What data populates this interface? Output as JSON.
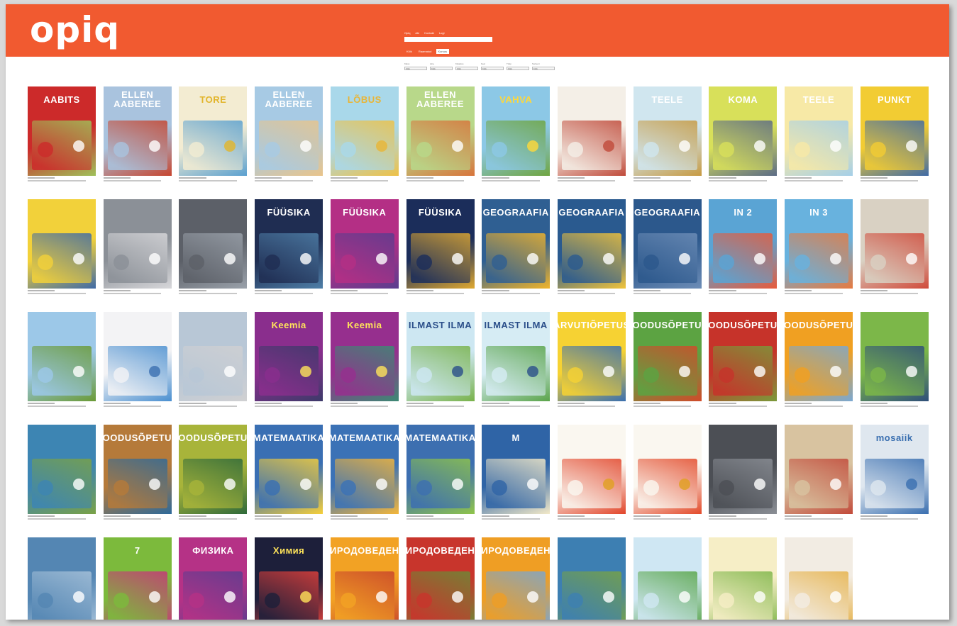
{
  "colors": {
    "accent": "#f15a30"
  },
  "header": {
    "logo": "opiq",
    "nav": [
      "Opiq",
      "Abi",
      "Kontakt",
      "Logi"
    ],
    "search_placeholder": "",
    "tabs": [
      {
        "label": "Kõik",
        "active": false
      },
      {
        "label": "Raamatud",
        "active": false
      },
      {
        "label": "Kursus",
        "active": true
      }
    ],
    "filters": [
      {
        "label": "Klass",
        "value": "Kõik"
      },
      {
        "label": "Aine",
        "value": "Kõik"
      },
      {
        "label": "Kirjastus",
        "value": "Kõik"
      },
      {
        "label": "Keel",
        "value": "Kõik"
      },
      {
        "label": "Tüüp",
        "value": "Kõik"
      },
      {
        "label": "Sorteeri",
        "value": "Kõik"
      }
    ]
  },
  "books": [
    [
      {
        "title": "AABITS",
        "c1": "#cc2a2a",
        "c2": "#9fc25a",
        "tc": "#ffffff"
      },
      {
        "title": "ELLEN AABEREE",
        "c1": "#a9c3de",
        "c2": "#c6452f",
        "tc": "#ffffff"
      },
      {
        "title": "TORE",
        "c1": "#f3ecd2",
        "c2": "#5aa0d0",
        "tc": "#e2b52a"
      },
      {
        "title": "ELLEN AABEREE",
        "c1": "#a7cae4",
        "c2": "#e9c48a",
        "tc": "#ffffff"
      },
      {
        "title": "LÕBUS",
        "c1": "#a9d8ea",
        "c2": "#eec146",
        "tc": "#e9b536"
      },
      {
        "title": "ELLEN AABEREE",
        "c1": "#b8d88a",
        "c2": "#d8743b",
        "tc": "#ffffff"
      },
      {
        "title": "VAHVA",
        "c1": "#8cc8e6",
        "c2": "#6fa540",
        "tc": "#ffd83a"
      },
      {
        "title": "",
        "c1": "#f4efe7",
        "c2": "#c04a3a",
        "tc": "#c04a3a"
      },
      {
        "title": "TEELE",
        "c1": "#d0e6ef",
        "c2": "#c79a42",
        "tc": "#ffffff"
      },
      {
        "title": "KOMA",
        "c1": "#d8e05a",
        "c2": "#5b6b86",
        "tc": "#ffffff"
      },
      {
        "title": "TEELE",
        "c1": "#f7e9a6",
        "c2": "#a5cfe8",
        "tc": "#ffffff"
      },
      {
        "title": "PUNKT",
        "c1": "#f2cc33",
        "c2": "#3f6aa6",
        "tc": "#ffffff"
      }
    ],
    [
      {
        "title": "",
        "c1": "#f2d13a",
        "c2": "#3f6aa6",
        "tc": "#ffffff"
      },
      {
        "title": "",
        "c1": "#8b9097",
        "c2": "#d7d7da",
        "tc": "#ffffff"
      },
      {
        "title": "",
        "c1": "#5c6068",
        "c2": "#9aa1aa",
        "tc": "#ffffff"
      },
      {
        "title": "FÜÜSIKA",
        "c1": "#1f2d52",
        "c2": "#4f7fa8",
        "tc": "#ffffff"
      },
      {
        "title": "FÜÜSIKA",
        "c1": "#b42f85",
        "c2": "#5a3d8f",
        "tc": "#ffffff"
      },
      {
        "title": "FÜÜSIKA",
        "c1": "#1b2d5a",
        "c2": "#e0a931",
        "tc": "#ffffff"
      },
      {
        "title": "GEOGRAAFIA",
        "c1": "#2f5f92",
        "c2": "#f1b42a",
        "tc": "#ffffff"
      },
      {
        "title": "GEOGRAAFIA",
        "c1": "#2a5a8f",
        "c2": "#f2c43a",
        "tc": "#ffffff"
      },
      {
        "title": "GEOGRAAFIA",
        "c1": "#2c588c",
        "c2": "#6d8db7",
        "tc": "#ffffff"
      },
      {
        "title": "IN 2",
        "c1": "#5aa4d4",
        "c2": "#e85a3a",
        "tc": "#ffffff"
      },
      {
        "title": "IN 3",
        "c1": "#68b2de",
        "c2": "#e77a40",
        "tc": "#ffffff"
      },
      {
        "title": "",
        "c1": "#d9d1c3",
        "c2": "#d04a3a",
        "tc": "#ffffff"
      }
    ],
    [
      {
        "title": "",
        "c1": "#9cc8e8",
        "c2": "#6a9a36",
        "tc": "#ffffff"
      },
      {
        "title": "",
        "c1": "#f3f3f5",
        "c2": "#4a8fd0",
        "tc": "#3b6fb0"
      },
      {
        "title": "",
        "c1": "#b8c7d6",
        "c2": "#d0d0d2",
        "tc": "#ffffff"
      },
      {
        "title": "Keemia",
        "c1": "#8a2e8d",
        "c2": "#3d3a6a",
        "tc": "#ffe45a"
      },
      {
        "title": "Keemia",
        "c1": "#962f8e",
        "c2": "#3c8a74",
        "tc": "#ffe45a"
      },
      {
        "title": "ILMAST ILMA",
        "c1": "#cde7f2",
        "c2": "#78b24a",
        "tc": "#2b4f8a"
      },
      {
        "title": "ILMAST ILMA",
        "c1": "#d6ecf4",
        "c2": "#5aa44a",
        "tc": "#2b4f8a"
      },
      {
        "title": "ARVUTIÕPETUS",
        "c1": "#f6d233",
        "c2": "#3a6fb0",
        "tc": "#ffffff"
      },
      {
        "title": "LOODUSÕPETUS",
        "c1": "#5ca342",
        "c2": "#d24a2a",
        "tc": "#ffffff"
      },
      {
        "title": "LOODUSÕPETUS",
        "c1": "#c6332a",
        "c2": "#7a9a3a",
        "tc": "#ffffff"
      },
      {
        "title": "LOODUSÕPETUS",
        "c1": "#f0a022",
        "c2": "#7aa8d2",
        "tc": "#ffffff"
      },
      {
        "title": "",
        "c1": "#7cb749",
        "c2": "#2f4f7a",
        "tc": "#ffffff"
      }
    ],
    [
      {
        "title": "",
        "c1": "#3d85b3",
        "c2": "#7aa246",
        "tc": "#ffffff"
      },
      {
        "title": "LOODUSÕPETUS",
        "c1": "#b57a3a",
        "c2": "#2e6a9a",
        "tc": "#ffffff"
      },
      {
        "title": "LOODUSÕPETUS",
        "c1": "#a8b43a",
        "c2": "#2f6a3a",
        "tc": "#ffffff"
      },
      {
        "title": "MATEMAATIKA",
        "c1": "#3a6fb3",
        "c2": "#f6cf3a",
        "tc": "#ffffff"
      },
      {
        "title": "MATEMAATIKA",
        "c1": "#3b72b6",
        "c2": "#f4b63a",
        "tc": "#ffffff"
      },
      {
        "title": "MATEMAATIKA",
        "c1": "#3d6fb0",
        "c2": "#8fc44a",
        "tc": "#ffffff"
      },
      {
        "title": "M",
        "c1": "#2f64a6",
        "c2": "#f3e9c8",
        "tc": "#ffffff"
      },
      {
        "title": "",
        "c1": "#faf7f0",
        "c2": "#e2452a",
        "tc": "#e0a020"
      },
      {
        "title": "",
        "c1": "#faf7f0",
        "c2": "#e34a2a",
        "tc": "#e0a020"
      },
      {
        "title": "",
        "c1": "#4c4f55",
        "c2": "#8a8e95",
        "tc": "#ffffff"
      },
      {
        "title": "",
        "c1": "#d8c3a0",
        "c2": "#c24a3a",
        "tc": "#ffffff"
      },
      {
        "title": "mosaiik",
        "c1": "#dfe7ef",
        "c2": "#3a6fb0",
        "tc": "#3a6fb0"
      }
    ],
    [
      {
        "title": "",
        "c1": "#5486b3",
        "c2": "#a6c1d9",
        "tc": "#ffffff"
      },
      {
        "title": "7",
        "c1": "#7cba3c",
        "c2": "#c8357a",
        "tc": "#ffffff"
      },
      {
        "title": "ФИЗИКА",
        "c1": "#b53286",
        "c2": "#5c3d90",
        "tc": "#ffffff"
      },
      {
        "title": "Химия",
        "c1": "#1d1f3a",
        "c2": "#e0403a",
        "tc": "#ffe45a"
      },
      {
        "title": "ПРИРОДОВЕДЕНИЕ",
        "c1": "#f2a224",
        "c2": "#c9452a",
        "tc": "#ffffff"
      },
      {
        "title": "ПРИРОДОВЕДЕНИЕ",
        "c1": "#c8352c",
        "c2": "#6b8a36",
        "tc": "#ffffff"
      },
      {
        "title": "ПРИРОДОВЕДЕНИЕ",
        "c1": "#ef9e24",
        "c2": "#7aa6d0",
        "tc": "#ffffff"
      },
      {
        "title": "",
        "c1": "#3d7fb2",
        "c2": "#78a244",
        "tc": "#ffffff"
      },
      {
        "title": "",
        "c1": "#cfe7f3",
        "c2": "#5aa64a",
        "tc": "#ffffff"
      },
      {
        "title": "",
        "c1": "#f6eec6",
        "c2": "#7fb64a",
        "tc": "#ffffff"
      },
      {
        "title": "",
        "c1": "#f2ece3",
        "c2": "#e6b24a",
        "tc": "#ffffff"
      }
    ]
  ]
}
